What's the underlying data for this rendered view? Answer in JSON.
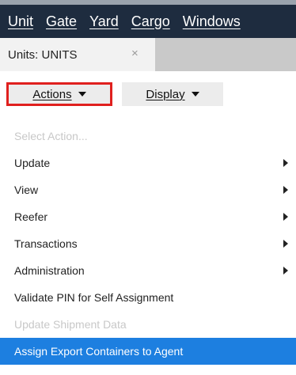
{
  "menubar": {
    "items": [
      {
        "label": "Unit"
      },
      {
        "label": "Gate"
      },
      {
        "label": "Yard"
      },
      {
        "label": "Cargo"
      },
      {
        "label": "Windows"
      }
    ]
  },
  "tab": {
    "title": "Units: UNITS",
    "close_icon": "×"
  },
  "toolbar": {
    "actions_label": "Actions",
    "display_label": "Display"
  },
  "menu": {
    "items": [
      {
        "label": "Select Action...",
        "state": "disabled"
      },
      {
        "label": "Update",
        "submenu": true
      },
      {
        "label": "View",
        "submenu": true
      },
      {
        "label": "Reefer",
        "submenu": true
      },
      {
        "label": "Transactions",
        "submenu": true
      },
      {
        "label": "Administration",
        "submenu": true
      },
      {
        "label": "Validate PIN for Self Assignment"
      },
      {
        "label": "Update Shipment Data",
        "state": "disabled"
      },
      {
        "label": "Assign Export Containers to Agent",
        "state": "selected"
      }
    ]
  },
  "colors": {
    "menubar_bg": "#1e2c3f",
    "highlight_border": "#e0201e",
    "selected_bg": "#1d7fe0"
  }
}
